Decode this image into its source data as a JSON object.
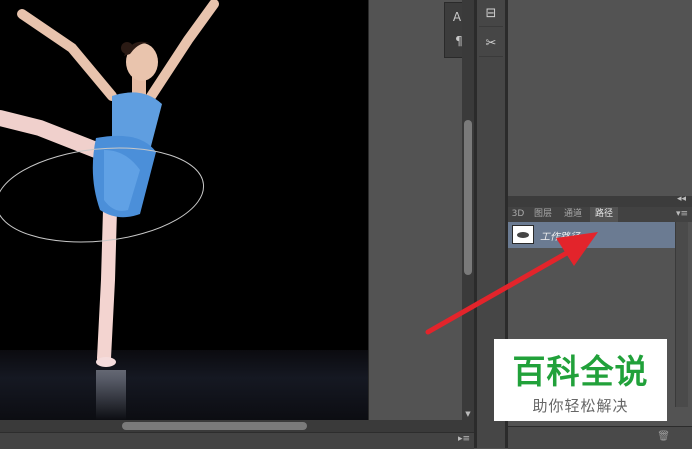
{
  "canvas": {
    "subject": "ballerina photo on black stage"
  },
  "mini_dock": {
    "buttons": [
      {
        "icon": "character-icon",
        "glyph": "A|"
      },
      {
        "icon": "paragraph-icon",
        "glyph": "¶"
      }
    ]
  },
  "tool_dock": {
    "buttons": [
      {
        "icon": "layer-comps-icon",
        "glyph": "⊟"
      },
      {
        "icon": "tools-preset-icon",
        "glyph": "✂"
      }
    ]
  },
  "panel": {
    "collapse_glyph": "◂◂",
    "menu_glyph": "▾≡",
    "tabs": [
      {
        "label": "3D",
        "active": false
      },
      {
        "label": "图层",
        "active": false
      },
      {
        "label": "通道",
        "active": false
      },
      {
        "label": "路径",
        "active": true
      }
    ],
    "paths": [
      {
        "name": "工作路径",
        "selected": true
      }
    ],
    "trash_glyph": "🗑"
  },
  "status_menu_glyph": "▸≡",
  "watermark": {
    "title": "百科全说",
    "subtitle": "助你轻松解决"
  },
  "colors": {
    "selection_row": "#6b7b92",
    "annotation_arrow": "#e3242b",
    "watermark_green": "#21a13a"
  }
}
